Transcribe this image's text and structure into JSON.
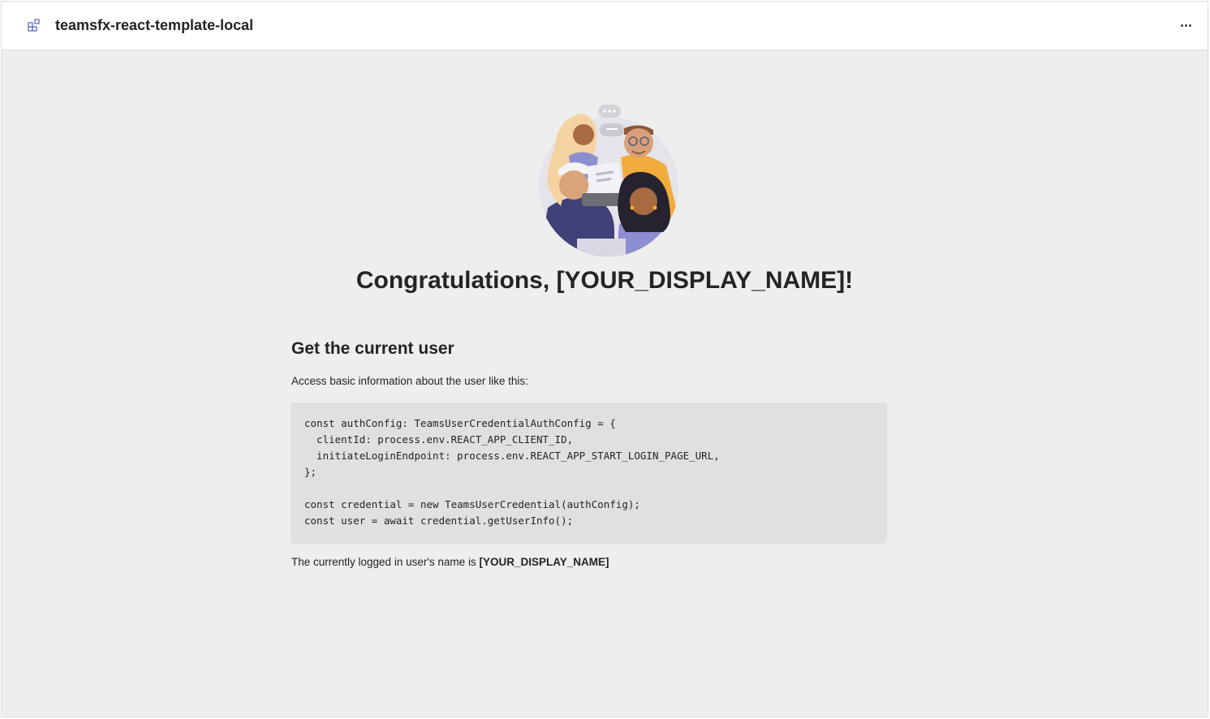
{
  "app": {
    "title": "teamsfx-react-template-local",
    "icon": "apps-grid-icon",
    "more_icon": "more-horizontal-icon"
  },
  "hero": {
    "image": "team-illustration"
  },
  "welcome": {
    "title": "Congratulations, [YOUR_DISPLAY_NAME]!"
  },
  "section": {
    "heading": "Get the current user",
    "description": "Access basic information about the user like this:",
    "code_lines": [
      "const authConfig: TeamsUserCredentialAuthConfig = {",
      "  clientId: process.env.REACT_APP_CLIENT_ID,",
      "  initiateLoginEndpoint: process.env.REACT_APP_START_LOGIN_PAGE_URL,",
      "};",
      "",
      "const credential = new TeamsUserCredential(authConfig);",
      "const user = await credential.getUserInfo();"
    ],
    "user_name_prefix": "The currently logged in user's name is ",
    "user_name": "[YOUR_DISPLAY_NAME]"
  },
  "colors": {
    "background": "#eeeeee",
    "header": "#ffffff",
    "code_background": "#e0e0e0",
    "text": "#242424",
    "accent": "#5b5fc7"
  }
}
